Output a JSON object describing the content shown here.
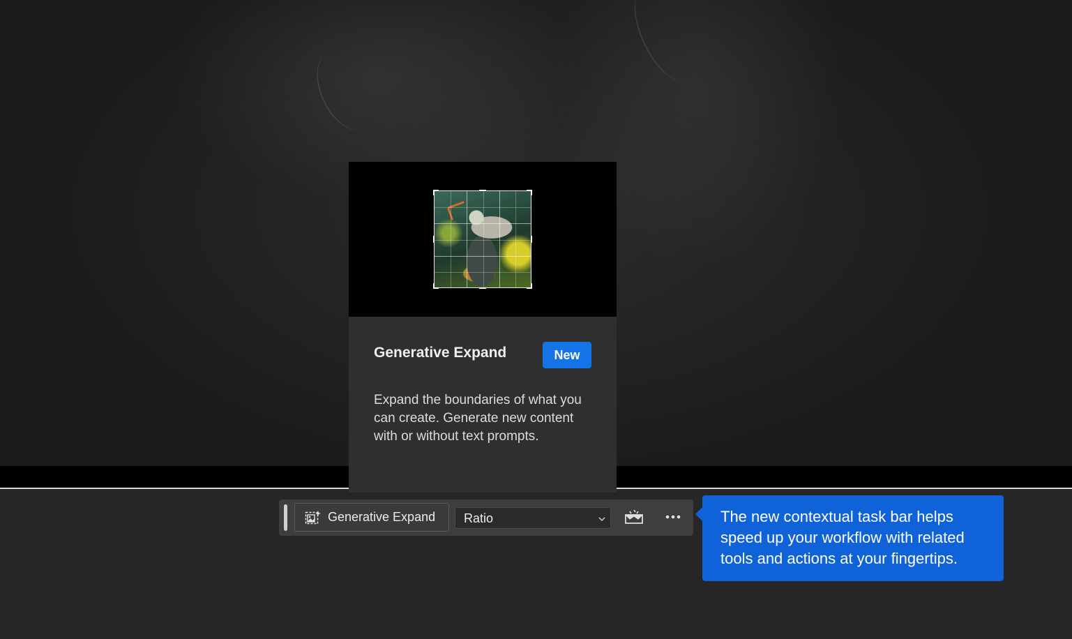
{
  "card": {
    "title": "Generative Expand",
    "badge": "New",
    "description": "Expand the boundaries of what you can create. Generate new content with or without text prompts."
  },
  "taskbar": {
    "generative_expand_label": "Generative Expand",
    "ratio_value": "Ratio",
    "icons": {
      "generative_expand": "generative-expand-icon",
      "ratio_dropdown": "chevron-down-icon",
      "mask": "mask-icon",
      "more": "more-options-icon"
    }
  },
  "callout": {
    "text": "The new contextual task bar helps speed up your workflow with related tools and actions at your fingertips."
  },
  "colors": {
    "accent": "#1473e6",
    "callout": "#0f62d8",
    "taskbar": "#3e3e3e",
    "workspace": "#262626"
  }
}
